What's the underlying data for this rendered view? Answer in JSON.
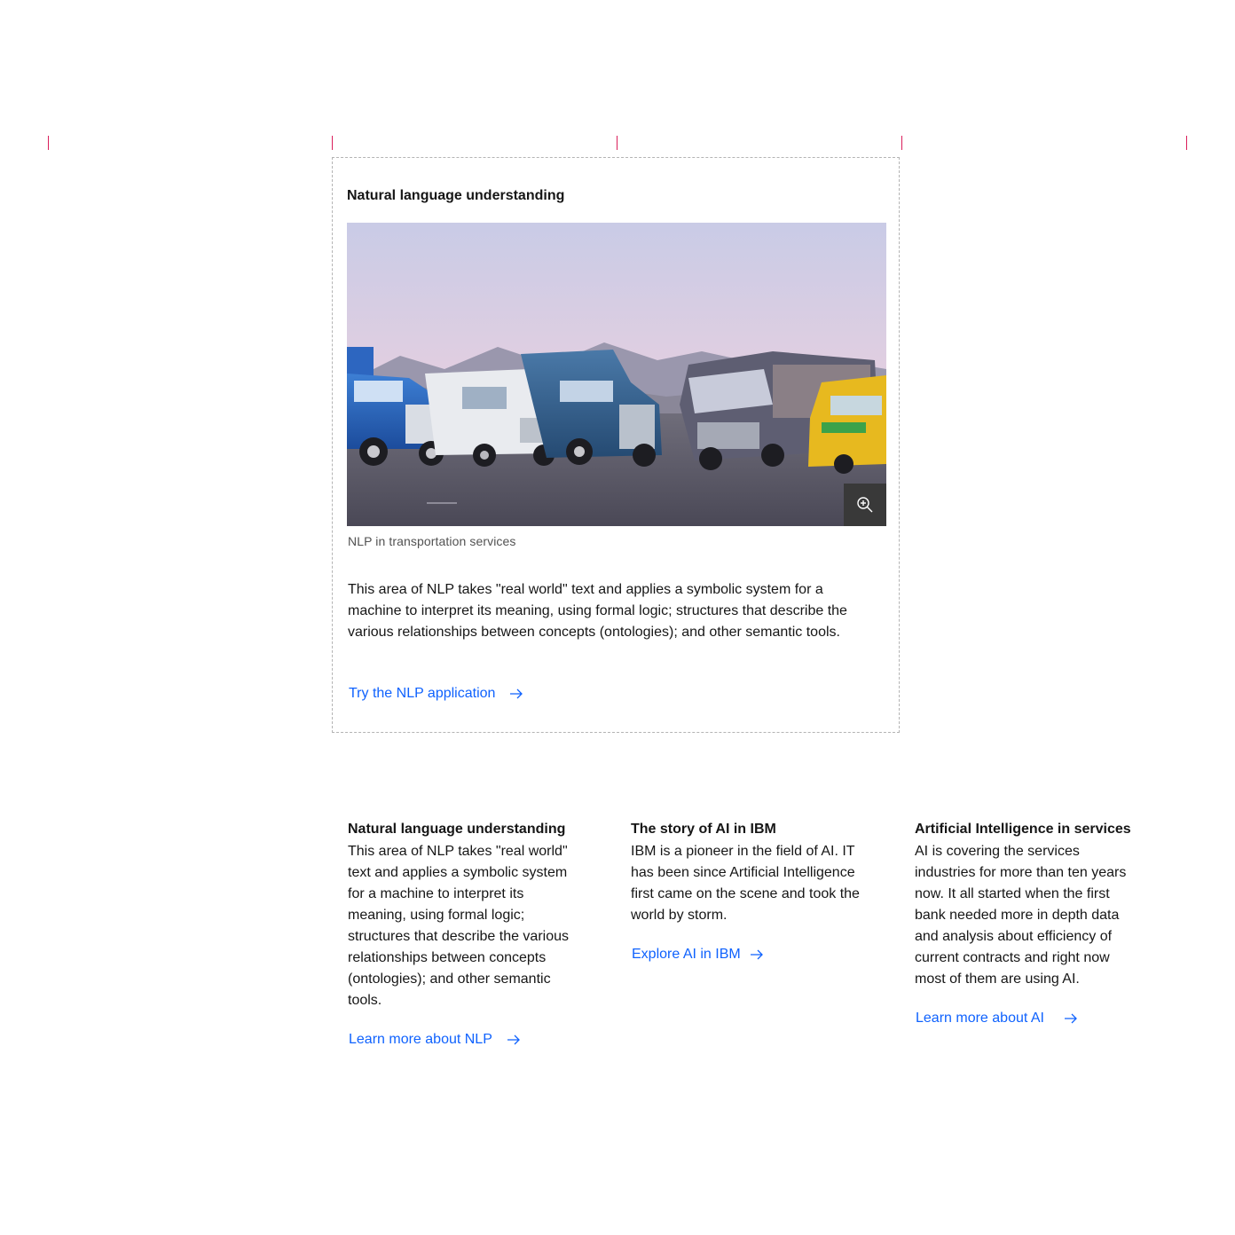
{
  "feature": {
    "title": "Natural language understanding",
    "image_alt": "Trucks, vans and buses lined up in a desert parking lot",
    "zoom_icon": "zoom-in-icon",
    "caption": "NLP in transportation services",
    "body": "This area of NLP takes \"real world\" text and applies a symbolic system for a machine to interpret its meaning, using formal logic; structures that describe the various relationships between concepts (ontologies); and other semantic tools.",
    "link_label": "Try the NLP application",
    "link_icon": "arrow-right-icon"
  },
  "columns": [
    {
      "title": "Natural language understanding",
      "body": "This area of NLP takes \"real world\" text and applies a symbolic system for a machine to interpret its meaning, using formal logic; structures that describe the various relationships between concepts (ontologies); and other semantic tools.",
      "link_label": "Learn more about NLP"
    },
    {
      "title": "The story of AI in IBM",
      "body": "IBM is a pioneer in the field of AI. IT has been since Artificial Intelligence first came on the scene and took the world by storm.",
      "link_label": "Explore AI in IBM"
    },
    {
      "title": "Artificial Intelligence in services",
      "body": "AI is covering the services industries for more than ten years now. It all started when the first bank needed more in depth data and analysis about efficiency of current contracts and right now most of them are using AI.",
      "link_label": "Learn more about AI"
    }
  ],
  "colors": {
    "link": "#0f62fe",
    "guide": "#da1e5a",
    "text": "#161616",
    "caption": "#525252"
  }
}
